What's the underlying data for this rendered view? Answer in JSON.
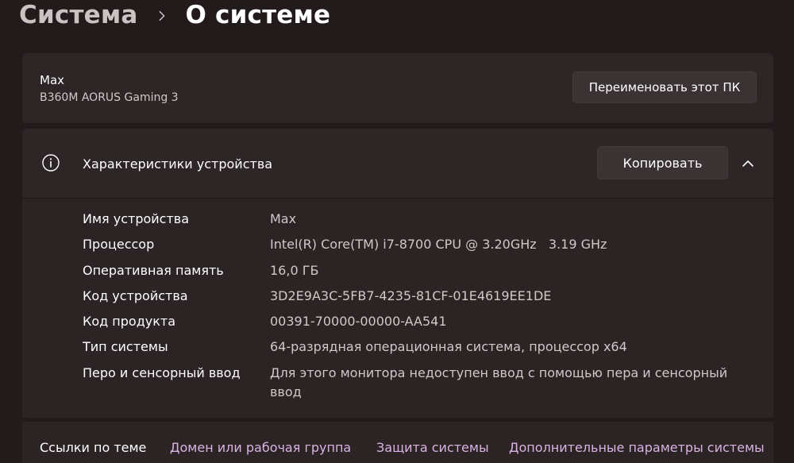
{
  "breadcrumb": {
    "parent": "Система",
    "current": "О системе"
  },
  "device": {
    "name": "Max",
    "model": "B360M AORUS Gaming 3",
    "rename_label": "Переименовать этот ПК"
  },
  "specs": {
    "title": "Характеристики устройства",
    "copy_label": "Копировать",
    "rows": [
      {
        "label": "Имя устройства",
        "value": "Max"
      },
      {
        "label": "Процессор",
        "value": "Intel(R) Core(TM) i7-8700 CPU @ 3.20GHz   3.19 GHz"
      },
      {
        "label": "Оперативная память",
        "value": "16,0 ГБ"
      },
      {
        "label": "Код устройства",
        "value": "3D2E9A3C-5FB7-4235-81CF-01E4619EE1DE"
      },
      {
        "label": "Код продукта",
        "value": "00391-70000-00000-AA541"
      },
      {
        "label": "Тип системы",
        "value": "64-разрядная операционная система, процессор x64"
      },
      {
        "label": "Перо и сенсорный ввод",
        "value": "Для этого монитора недоступен ввод с помощью пера и сенсорный ввод"
      }
    ]
  },
  "related": {
    "label": "Ссылки по теме",
    "links": [
      "Домен или рабочая группа",
      "Защита системы",
      "Дополнительные параметры системы"
    ]
  },
  "icons": {
    "breadcrumb_separator": "chevron-right-icon",
    "specs_icon": "info-icon",
    "collapse": "chevron-up-icon"
  },
  "colors": {
    "background": "#221a1b",
    "card": "#2d2526",
    "link": "#d9b3e3"
  }
}
